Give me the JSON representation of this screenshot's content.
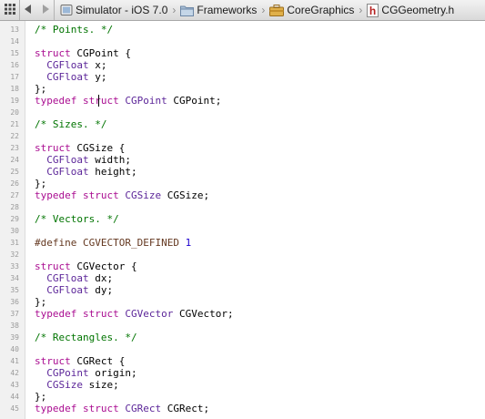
{
  "jumpbar": {
    "items": [
      {
        "label": "Simulator - iOS 7.0",
        "icon": "sdk-icon"
      },
      {
        "label": "Frameworks",
        "icon": "folder-icon"
      },
      {
        "label": "CoreGraphics",
        "icon": "framework-icon"
      },
      {
        "label": "CGGeometry.h",
        "icon": "header-file-icon"
      }
    ],
    "header_icon_glyph": "h"
  },
  "editor": {
    "language": "objective-c",
    "colors": {
      "keyword": "#aa0d91",
      "type": "#5c2699",
      "comment": "#007400",
      "number": "#1c00cf",
      "preprocessor": "#643820"
    },
    "lines": [
      {
        "n": "13",
        "tokens": [
          {
            "t": "/* Points. */",
            "k": "comment"
          }
        ]
      },
      {
        "n": "14",
        "tokens": []
      },
      {
        "n": "15",
        "tokens": [
          {
            "t": "struct",
            "k": "kw"
          },
          {
            "t": " CGPoint {",
            "k": "plain"
          }
        ]
      },
      {
        "n": "16",
        "tokens": [
          {
            "t": "  ",
            "k": "plain"
          },
          {
            "t": "CGFloat",
            "k": "type"
          },
          {
            "t": " x;",
            "k": "plain"
          }
        ]
      },
      {
        "n": "17",
        "tokens": [
          {
            "t": "  ",
            "k": "plain"
          },
          {
            "t": "CGFloat",
            "k": "type"
          },
          {
            "t": " y;",
            "k": "plain"
          }
        ]
      },
      {
        "n": "18",
        "tokens": [
          {
            "t": "};",
            "k": "plain"
          }
        ]
      },
      {
        "n": "19",
        "tokens": [
          {
            "t": "typedef",
            "k": "kw"
          },
          {
            "t": " ",
            "k": "plain"
          },
          {
            "t": "struct",
            "k": "kw"
          },
          {
            "t": " ",
            "k": "plain"
          },
          {
            "t": "CGPoint",
            "k": "type"
          },
          {
            "t": " CGPoint;",
            "k": "plain"
          }
        ]
      },
      {
        "n": "20",
        "tokens": []
      },
      {
        "n": "21",
        "tokens": [
          {
            "t": "/* Sizes. */",
            "k": "comment"
          }
        ]
      },
      {
        "n": "22",
        "tokens": []
      },
      {
        "n": "23",
        "tokens": [
          {
            "t": "struct",
            "k": "kw"
          },
          {
            "t": " CGSize {",
            "k": "plain"
          }
        ]
      },
      {
        "n": "24",
        "tokens": [
          {
            "t": "  ",
            "k": "plain"
          },
          {
            "t": "CGFloat",
            "k": "type"
          },
          {
            "t": " width;",
            "k": "plain"
          }
        ]
      },
      {
        "n": "25",
        "tokens": [
          {
            "t": "  ",
            "k": "plain"
          },
          {
            "t": "CGFloat",
            "k": "type"
          },
          {
            "t": " height;",
            "k": "plain"
          }
        ]
      },
      {
        "n": "26",
        "tokens": [
          {
            "t": "};",
            "k": "plain"
          }
        ]
      },
      {
        "n": "27",
        "tokens": [
          {
            "t": "typedef",
            "k": "kw"
          },
          {
            "t": " ",
            "k": "plain"
          },
          {
            "t": "struct",
            "k": "kw"
          },
          {
            "t": " ",
            "k": "plain"
          },
          {
            "t": "CGSize",
            "k": "type"
          },
          {
            "t": " CGSize;",
            "k": "plain"
          }
        ]
      },
      {
        "n": "28",
        "tokens": []
      },
      {
        "n": "29",
        "tokens": [
          {
            "t": "/* Vectors. */",
            "k": "comment"
          }
        ]
      },
      {
        "n": "30",
        "tokens": []
      },
      {
        "n": "31",
        "tokens": [
          {
            "t": "#define",
            "k": "pre"
          },
          {
            "t": " CGVECTOR_DEFINED ",
            "k": "pre"
          },
          {
            "t": "1",
            "k": "num"
          }
        ]
      },
      {
        "n": "32",
        "tokens": []
      },
      {
        "n": "33",
        "tokens": [
          {
            "t": "struct",
            "k": "kw"
          },
          {
            "t": " CGVector {",
            "k": "plain"
          }
        ]
      },
      {
        "n": "34",
        "tokens": [
          {
            "t": "  ",
            "k": "plain"
          },
          {
            "t": "CGFloat",
            "k": "type"
          },
          {
            "t": " dx;",
            "k": "plain"
          }
        ]
      },
      {
        "n": "35",
        "tokens": [
          {
            "t": "  ",
            "k": "plain"
          },
          {
            "t": "CGFloat",
            "k": "type"
          },
          {
            "t": " dy;",
            "k": "plain"
          }
        ]
      },
      {
        "n": "36",
        "tokens": [
          {
            "t": "};",
            "k": "plain"
          }
        ]
      },
      {
        "n": "37",
        "tokens": [
          {
            "t": "typedef",
            "k": "kw"
          },
          {
            "t": " ",
            "k": "plain"
          },
          {
            "t": "struct",
            "k": "kw"
          },
          {
            "t": " ",
            "k": "plain"
          },
          {
            "t": "CGVector",
            "k": "type"
          },
          {
            "t": " CGVector;",
            "k": "plain"
          }
        ]
      },
      {
        "n": "38",
        "tokens": []
      },
      {
        "n": "39",
        "tokens": [
          {
            "t": "/* Rectangles. */",
            "k": "comment"
          }
        ]
      },
      {
        "n": "40",
        "tokens": []
      },
      {
        "n": "41",
        "tokens": [
          {
            "t": "struct",
            "k": "kw"
          },
          {
            "t": " CGRect {",
            "k": "plain"
          }
        ]
      },
      {
        "n": "42",
        "tokens": [
          {
            "t": "  ",
            "k": "plain"
          },
          {
            "t": "CGPoint",
            "k": "type"
          },
          {
            "t": " origin;",
            "k": "plain"
          }
        ]
      },
      {
        "n": "43",
        "tokens": [
          {
            "t": "  ",
            "k": "plain"
          },
          {
            "t": "CGSize",
            "k": "type"
          },
          {
            "t": " size;",
            "k": "plain"
          }
        ]
      },
      {
        "n": "44",
        "tokens": [
          {
            "t": "};",
            "k": "plain"
          }
        ]
      },
      {
        "n": "45",
        "tokens": [
          {
            "t": "typedef",
            "k": "kw"
          },
          {
            "t": " ",
            "k": "plain"
          },
          {
            "t": "struct",
            "k": "kw"
          },
          {
            "t": " ",
            "k": "plain"
          },
          {
            "t": "CGRect",
            "k": "type"
          },
          {
            "t": " CGRect;",
            "k": "plain"
          }
        ]
      }
    ]
  }
}
